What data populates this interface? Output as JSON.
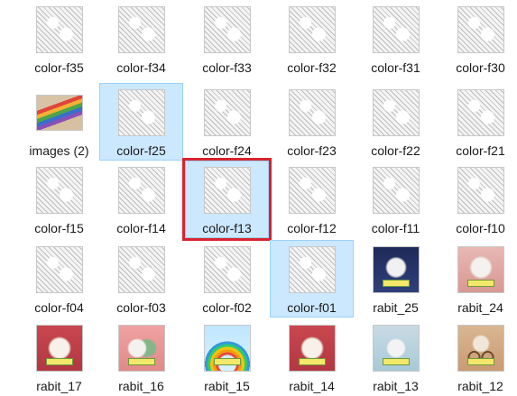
{
  "files": [
    {
      "name": "color-f35"
    },
    {
      "name": "color-f34"
    },
    {
      "name": "color-f33"
    },
    {
      "name": "color-f32"
    },
    {
      "name": "color-f31"
    },
    {
      "name": "color-f30"
    },
    {
      "name": "images (2)"
    },
    {
      "name": "color-f25"
    },
    {
      "name": "color-f24"
    },
    {
      "name": "color-f23"
    },
    {
      "name": "color-f22"
    },
    {
      "name": "color-f21"
    },
    {
      "name": "color-f15"
    },
    {
      "name": "color-f14"
    },
    {
      "name": "color-f13"
    },
    {
      "name": "color-f12"
    },
    {
      "name": "color-f11"
    },
    {
      "name": "color-f10"
    },
    {
      "name": "color-f04"
    },
    {
      "name": "color-f03"
    },
    {
      "name": "color-f02"
    },
    {
      "name": "color-f01"
    },
    {
      "name": "rabit_25"
    },
    {
      "name": "rabit_24"
    },
    {
      "name": "rabit_17"
    },
    {
      "name": "rabit_16"
    },
    {
      "name": "rabit_15"
    },
    {
      "name": "rabit_14"
    },
    {
      "name": "rabit_13"
    },
    {
      "name": "rabit_12"
    }
  ],
  "colors": {
    "selection_bg": "#cce8ff",
    "selection_border": "#99d1ff",
    "highlight_box": "#d9232e"
  }
}
